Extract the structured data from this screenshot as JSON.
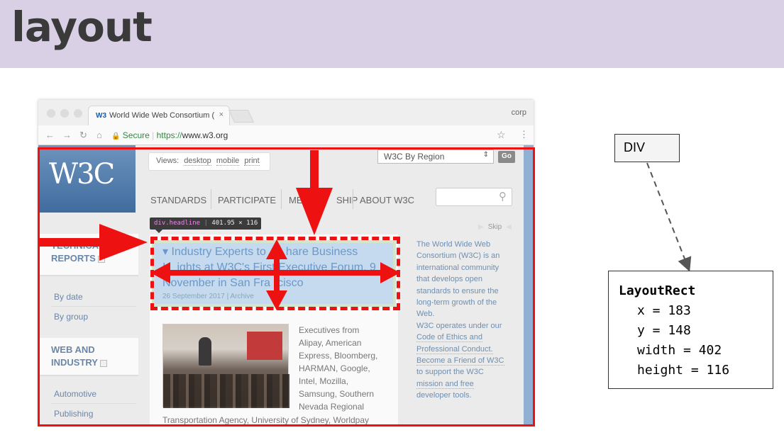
{
  "slide": {
    "title": "layout"
  },
  "browser": {
    "tab_title": "World Wide Web Consortium (",
    "tab_favicon": "W3",
    "tab_close": "×",
    "profile": "corp",
    "secure_label": "Secure",
    "url_prefix": "https://",
    "url_host": "www.w3.org",
    "nav_icons": [
      "back-arrow-icon",
      "forward-arrow-icon",
      "reload-icon",
      "home-icon"
    ]
  },
  "w3c": {
    "logo_text": "W3C",
    "views_label": "Views:",
    "views": [
      "desktop",
      "mobile",
      "print"
    ],
    "region_select": "W3C By Region",
    "go_label": "Go",
    "nav": [
      "STANDARDS",
      "PARTICIPATE",
      "ME",
      "SHIP",
      "ABOUT W3C"
    ],
    "skip": "Skip",
    "sidebar": {
      "section1": [
        "TECHNICA",
        "REPORTS"
      ],
      "section1_links": [
        "By date",
        "By group"
      ],
      "section2": [
        "WEB AND",
        "INDUSTRY"
      ],
      "section2_links": [
        "Automotive",
        "Publishing"
      ]
    },
    "tooltip": {
      "selector": "div",
      "class": ".headline",
      "size": "401.95 × 116"
    },
    "headline": {
      "line1a": "Industry Experts to",
      "line1b": "hare Business",
      "line2a": "I",
      "line2b": "ights at W3C's First Executive Forum, 9",
      "line3a": "November in San Fra",
      "line3b": "cisco",
      "date": "26 September 2017 | Archive"
    },
    "body_lines": [
      "Executives from",
      "Alipay, American",
      "Express, Bloomberg,",
      "HARMAN, Google,",
      "Intel, Mozilla,",
      "Samsung, Southern",
      "Nevada Regional"
    ],
    "bottom_line": "Transportation Agency, University of Sydney, Worldpay",
    "aside_lines": [
      "The World Wide Web",
      "Consortium (W3C) is an",
      "international community",
      "that develops open",
      "standards to ensure the",
      "long-term growth of the",
      "Web.",
      "W3C operates under our",
      "Code of Ethics and",
      "Professional Conduct.",
      "Become a Friend of W3C",
      "to support the W3C",
      "mission and free",
      "developer tools."
    ]
  },
  "diagram": {
    "node_label": "DIV",
    "rect_title": "LayoutRect",
    "rect_fields": [
      "x = 183",
      "y = 148",
      "width = 402",
      "height = 116"
    ]
  },
  "colors": {
    "annotation_red": "#ee1111",
    "header_band": "#d9d0e6"
  }
}
